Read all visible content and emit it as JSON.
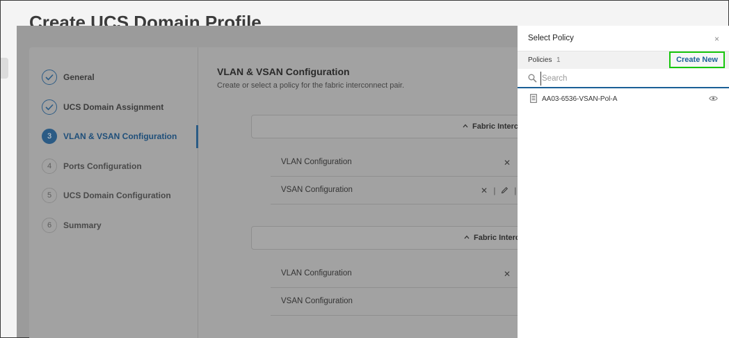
{
  "page": {
    "title": "Create UCS Domain Profile"
  },
  "steps": [
    {
      "number": "",
      "label": "General",
      "state": "done"
    },
    {
      "number": "",
      "label": "UCS Domain Assignment",
      "state": "done"
    },
    {
      "number": "3",
      "label": "VLAN & VSAN Configuration",
      "state": "active"
    },
    {
      "number": "4",
      "label": "Ports Configuration",
      "state": "pending"
    },
    {
      "number": "5",
      "label": "UCS Domain Configuration",
      "state": "pending"
    },
    {
      "number": "6",
      "label": "Summary",
      "state": "pending"
    }
  ],
  "content": {
    "title": "VLAN & VSAN Configuration",
    "subtitle": "Create or select a policy for the fabric interconnect pair.",
    "fabric_a": {
      "header": "Fabric Interc",
      "rows": [
        {
          "label": "VLAN Configuration"
        },
        {
          "label": "VSAN Configuration"
        }
      ]
    },
    "fabric_b": {
      "header": "Fabric Interc",
      "rows": [
        {
          "label": "VLAN Configuration"
        },
        {
          "label": "VSAN Configuration"
        }
      ]
    }
  },
  "drawer": {
    "title": "Select Policy",
    "close_icon": "×",
    "policies_label": "Policies",
    "policies_count": "1",
    "create_new_label": "Create New",
    "search_placeholder": "Search",
    "policies": [
      {
        "name": "AA03-6536-VSAN-Pol-A"
      }
    ]
  },
  "colors": {
    "accent": "#1a5f96",
    "highlight_border": "#16c60c",
    "overlay": "#9b9b9b"
  }
}
